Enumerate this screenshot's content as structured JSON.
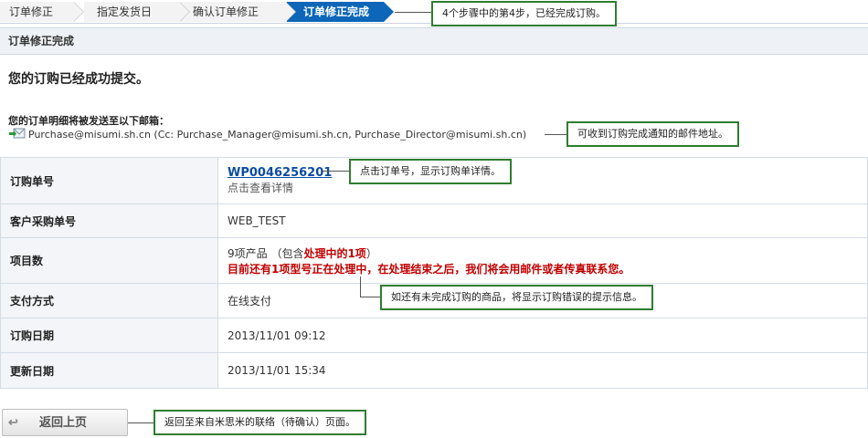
{
  "steps": [
    {
      "label": "订单修正"
    },
    {
      "label": "指定发货日"
    },
    {
      "label": "确认订单修正"
    },
    {
      "label": "订单修正完成"
    }
  ],
  "section_title": "订单修正完成",
  "success_message": "您的订购已经成功提交。",
  "mail": {
    "label": "您的订单明细将被发送至以下邮箱：",
    "addresses": "Purchase@misumi.sh.cn (Cc: Purchase_Manager@misumi.sh.cn, Purchase_Director@misumi.sh.cn)"
  },
  "table": {
    "order_no": {
      "label": "订购单号",
      "value": "WP0046256201",
      "sub": "点击查看详情"
    },
    "customer_po": {
      "label": "客户采购单号",
      "value": "WEB_TEST"
    },
    "items": {
      "label": "项目数",
      "value_prefix": "9项产品 （包含",
      "value_highlight": "处理中的1项",
      "value_suffix": "）",
      "warning": "目前还有1项型号正在处理中，在处理结束之后，我们将会用邮件或者传真联系您。"
    },
    "payment": {
      "label": "支付方式",
      "value": "在线支付"
    },
    "order_date": {
      "label": "订购日期",
      "value": "2013/11/01 09:12"
    },
    "update_date": {
      "label": "更新日期",
      "value": "2013/11/01 15:34"
    }
  },
  "back_button": {
    "label": "返回上页",
    "icon": "back-arrow-icon"
  },
  "callouts": {
    "step": "4个步骤中的第4步，已经完成订购。",
    "mail": "可收到订购完成通知的邮件地址。",
    "order_no": "点击订单号，显示订购单详情。",
    "error": "如还有未完成订购的商品，将显示订购错误的提示信息。",
    "back": "返回至来自米思米的联络（待确认）页面。"
  },
  "colors": {
    "active_step": "#0d66b8",
    "callout_border": "#2f7d2f",
    "warning": "#c00000",
    "link": "#0b4da2"
  }
}
